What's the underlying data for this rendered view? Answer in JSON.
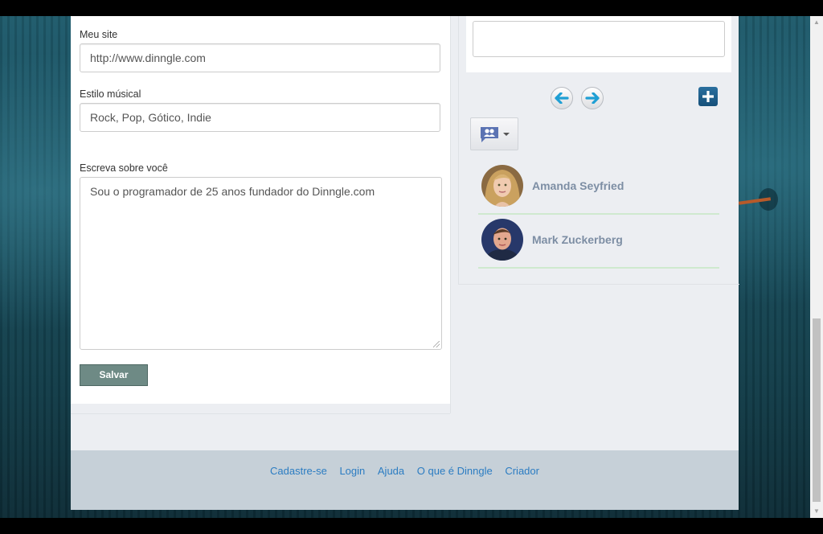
{
  "profile_form": {
    "site_label": "Meu site",
    "site_value": "http://www.dinngle.com",
    "music_label": "Estilo músical",
    "music_value": "Rock, Pop, Gótico, Indie",
    "about_label": "Escreva sobre você",
    "about_value": "Sou o programador de 25 anos fundador do Dinngle.com",
    "save_label": "Salvar"
  },
  "friends": [
    {
      "name": "Amanda Seyfried"
    },
    {
      "name": "Mark Zuckerberg"
    }
  ],
  "footer": {
    "links": [
      "Cadastre-se",
      "Login",
      "Ajuda",
      "O que é Dinngle",
      "Criador"
    ]
  },
  "colors": {
    "accent_blue": "#2b7cc2",
    "save_button": "#6e8a85",
    "friend_name": "#7d8ea4",
    "footer_bg": "#c6d0d8"
  },
  "icons": [
    "arrow-left-icon",
    "arrow-right-icon",
    "plus-icon",
    "chat-people-icon",
    "chevron-down-icon"
  ]
}
